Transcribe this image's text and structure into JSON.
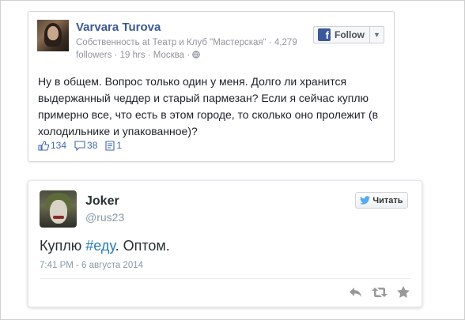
{
  "fb_post": {
    "author": "Varvara Turova",
    "meta_line1_pre": "Собственность ",
    "meta_line1_at": "at",
    "meta_line1_rest": " Театр и Клуб \"Мастерская\" · 4,279",
    "meta_line2": "followers · 19 hrs · Москва · ",
    "follow_label": "Follow",
    "text": "Ну в общем. Вопрос только один у меня. Долго ли хранится выдержанный чеддер и старый пармезан? Если я сейчас куплю примерно все, что есть в этом городе, то сколько оно пролежит (в холодильнике и упакованное)?",
    "likes": "134",
    "comments": "38",
    "shares": "1"
  },
  "tweet": {
    "name": "Joker",
    "handle": "@rus23",
    "follow_label": "Читать",
    "text_before": "Куплю ",
    "hashtag": "#еду",
    "text_after": ". Оптом.",
    "timestamp": "7:41 PM - 6 августа 2014"
  },
  "colors": {
    "facebook_blue": "#3b5998",
    "twitter_blue": "#55acee",
    "hashtag": "#2b7bb9"
  }
}
